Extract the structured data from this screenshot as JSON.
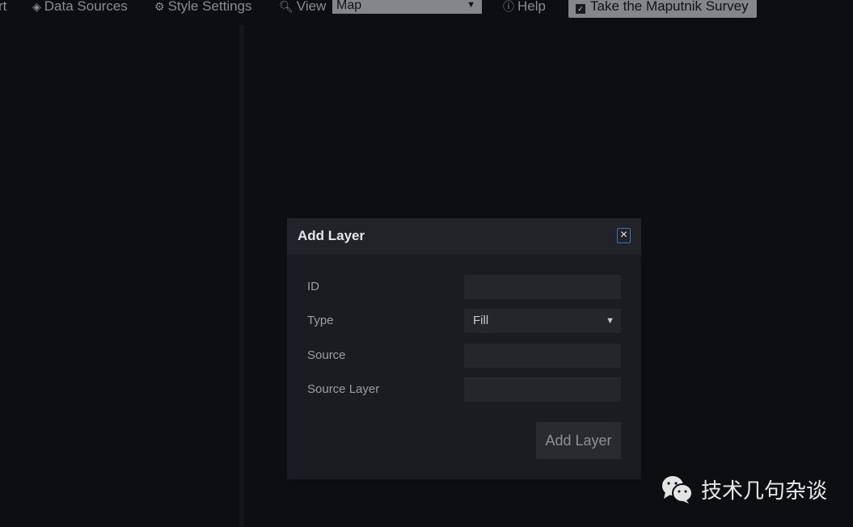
{
  "toolbar": {
    "export_label": "rt",
    "data_sources_label": "Data Sources",
    "style_settings_label": "Style Settings",
    "view_label": "View",
    "view_select_value": "Map",
    "help_label": "Help",
    "survey_label": "Take the Maputnik Survey"
  },
  "modal": {
    "title": "Add Layer",
    "fields": [
      {
        "label": "ID",
        "value": ""
      },
      {
        "label": "Type",
        "value": "Fill"
      },
      {
        "label": "Source",
        "value": ""
      },
      {
        "label": "Source Layer",
        "value": ""
      }
    ],
    "submit_label": "Add Layer"
  },
  "watermark": {
    "text": "技术几句杂谈"
  },
  "colors": {
    "accent": "#3f6fc4",
    "background": "#0d0e11",
    "modal": "#1b1c21"
  }
}
